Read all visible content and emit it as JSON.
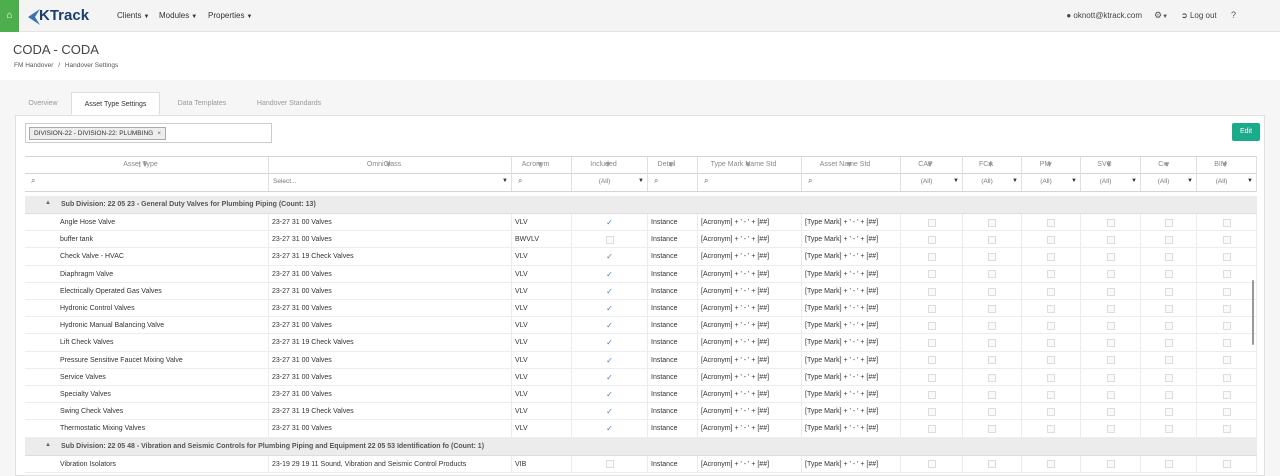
{
  "app": {
    "logo_text": "KTrack",
    "brand_color": "#1a3e6e",
    "accent_color": "#4cae4c",
    "edit_color": "#1aab8a"
  },
  "nav": {
    "clients": "Clients",
    "modules": "Modules",
    "properties": "Properties",
    "user": "oknott@ktrack.com",
    "logout": "Log out"
  },
  "page": {
    "title": "CODA - CODA",
    "breadcrumb_1": "FM Handover",
    "breadcrumb_sep": "/",
    "breadcrumb_2": "Handover Settings"
  },
  "tabs": [
    "Overview",
    "Asset Type Settings",
    "Data Templates",
    "Handover Standards"
  ],
  "active_tab": "Asset Type Settings",
  "filter": {
    "chip": "DIVISION-22 - DIVISION-22: PLUMBING"
  },
  "edit_label": "Edit",
  "columns": [
    "Asset Type",
    "OmniClass",
    "Acronym",
    "Included",
    "Detail",
    "Type Mark Name Std",
    "Asset Name Std",
    "CAP",
    "FCA",
    "PM",
    "SVC",
    "Cx",
    "BIM"
  ],
  "filters": {
    "omniclass_placeholder": "Select...",
    "all": "(All)"
  },
  "groups": [
    {
      "title": "Sub Division: 22 05 23 - General Duty Valves for Plumbing Piping (Count: 13)",
      "rows": [
        {
          "asset": "Angle Hose Valve",
          "omni": "23-27 31 00 Valves",
          "acr": "VLV",
          "inc": true,
          "detail": "Instance",
          "tm": "[Acronym] + ' - ' + [##]",
          "an": "[Type Mark] + ' - ' + [##]"
        },
        {
          "asset": "buffer tank",
          "omni": "23-27 31 00 Valves",
          "acr": "BWVLV",
          "inc": false,
          "detail": "Instance",
          "tm": "[Acronym] + ' - ' + [##]",
          "an": "[Type Mark] + ' - ' + [##]"
        },
        {
          "asset": "Check Valve - HVAC",
          "omni": "23-27 31 19 Check Valves",
          "acr": "VLV",
          "inc": true,
          "detail": "Instance",
          "tm": "[Acronym] + ' - ' + [##]",
          "an": "[Type Mark] + ' - ' + [##]"
        },
        {
          "asset": "Diaphragm Valve",
          "omni": "23-27 31 00 Valves",
          "acr": "VLV",
          "inc": true,
          "detail": "Instance",
          "tm": "[Acronym] + ' - ' + [##]",
          "an": "[Type Mark] + ' - ' + [##]"
        },
        {
          "asset": "Electrically Operated Gas Valves",
          "omni": "23-27 31 00 Valves",
          "acr": "VLV",
          "inc": true,
          "detail": "Instance",
          "tm": "[Acronym] + ' - ' + [##]",
          "an": "[Type Mark] + ' - ' + [##]"
        },
        {
          "asset": "Hydronic Control Valves",
          "omni": "23-27 31 00 Valves",
          "acr": "VLV",
          "inc": true,
          "detail": "Instance",
          "tm": "[Acronym] + ' - ' + [##]",
          "an": "[Type Mark] + ' - ' + [##]"
        },
        {
          "asset": "Hydronic Manual Balancing Valve",
          "omni": "23-27 31 00 Valves",
          "acr": "VLV",
          "inc": true,
          "detail": "Instance",
          "tm": "[Acronym] + ' - ' + [##]",
          "an": "[Type Mark] + ' - ' + [##]"
        },
        {
          "asset": "Lift Check Valves",
          "omni": "23-27 31 19 Check Valves",
          "acr": "VLV",
          "inc": true,
          "detail": "Instance",
          "tm": "[Acronym] + ' - ' + [##]",
          "an": "[Type Mark] + ' - ' + [##]"
        },
        {
          "asset": "Pressure Sensitive Faucet Mixing Valve",
          "omni": "23-27 31 00 Valves",
          "acr": "VLV",
          "inc": true,
          "detail": "Instance",
          "tm": "[Acronym] + ' - ' + [##]",
          "an": "[Type Mark] + ' - ' + [##]"
        },
        {
          "asset": "Service Valves",
          "omni": "23-27 31 00 Valves",
          "acr": "VLV",
          "inc": true,
          "detail": "Instance",
          "tm": "[Acronym] + ' - ' + [##]",
          "an": "[Type Mark] + ' - ' + [##]"
        },
        {
          "asset": "Specialty Valves",
          "omni": "23-27 31 00 Valves",
          "acr": "VLV",
          "inc": true,
          "detail": "Instance",
          "tm": "[Acronym] + ' - ' + [##]",
          "an": "[Type Mark] + ' - ' + [##]"
        },
        {
          "asset": "Swing Check Valves",
          "omni": "23-27 31 19 Check Valves",
          "acr": "VLV",
          "inc": true,
          "detail": "Instance",
          "tm": "[Acronym] + ' - ' + [##]",
          "an": "[Type Mark] + ' - ' + [##]"
        },
        {
          "asset": "Thermostatic Mixing Valves",
          "omni": "23-27 31 00 Valves",
          "acr": "VLV",
          "inc": true,
          "detail": "Instance",
          "tm": "[Acronym] + ' - ' + [##]",
          "an": "[Type Mark] + ' - ' + [##]"
        }
      ]
    },
    {
      "title": "Sub Division: 22 05 48 - Vibration and Seismic Controls for Plumbing Piping and Equipment 22 05 53 Identification fo (Count: 1)",
      "rows": [
        {
          "asset": "Vibration Isolators",
          "omni": "23-19 29 19 11 Sound, Vibration and Seismic Control Products",
          "acr": "VIB",
          "inc": false,
          "detail": "Instance",
          "tm": "[Acronym] + ' - ' + [##]",
          "an": "[Type Mark] + ' - ' + [##]"
        }
      ]
    }
  ]
}
